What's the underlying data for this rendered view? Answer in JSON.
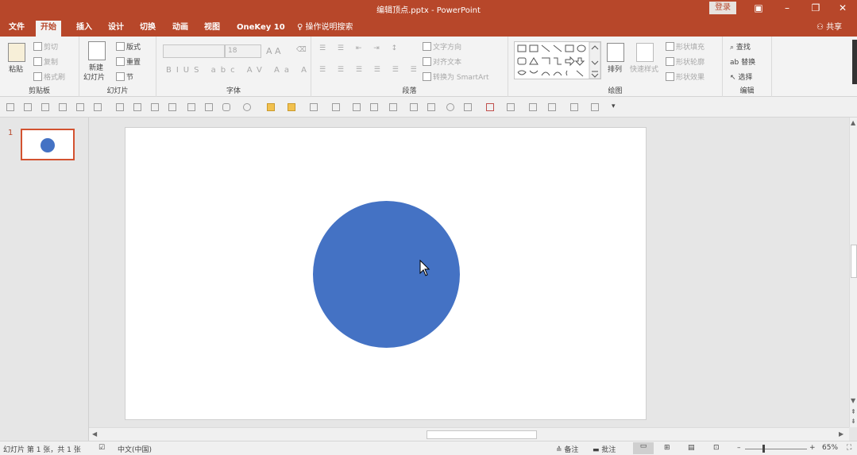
{
  "window": {
    "title": "编辑顶点.pptx - PowerPoint",
    "login": "登录"
  },
  "tabs": [
    {
      "label": "文件"
    },
    {
      "label": "开始"
    },
    {
      "label": "插入"
    },
    {
      "label": "设计"
    },
    {
      "label": "切换"
    },
    {
      "label": "动画"
    },
    {
      "label": "视图"
    },
    {
      "label": "OneKey 10"
    }
  ],
  "tell_me": "操作说明搜索",
  "share": "共享",
  "ribbon": {
    "clipboard": {
      "label": "剪贴板",
      "paste": "粘贴",
      "cut": "剪切",
      "copy": "复制",
      "format_painter": "格式刷"
    },
    "slides": {
      "label": "幻灯片",
      "new_slide": "新建",
      "new_slide2": "幻灯片",
      "layout": "版式",
      "reset": "重置",
      "section": "节"
    },
    "font": {
      "label": "字体",
      "size": "18"
    },
    "paragraph": {
      "label": "段落",
      "text_direction": "文字方向",
      "align_text": "对齐文本",
      "smartart": "转换为 SmartArt"
    },
    "drawing": {
      "label": "绘图",
      "arrange": "排列",
      "quick_styles": "快速样式",
      "shape_fill": "形状填充",
      "shape_outline": "形状轮廓",
      "shape_effects": "形状效果"
    },
    "editing": {
      "label": "编辑",
      "find": "查找",
      "replace": "替换",
      "select": "选择"
    }
  },
  "thumbnails": [
    {
      "number": "1"
    }
  ],
  "status": {
    "slide_info": "幻灯片 第 1 张，共 1 张",
    "language": "中文(中国)",
    "notes": "备注",
    "comments": "批注",
    "zoom": "65%"
  },
  "colors": {
    "accent": "#b7472a",
    "shape_fill": "#4472c4"
  }
}
